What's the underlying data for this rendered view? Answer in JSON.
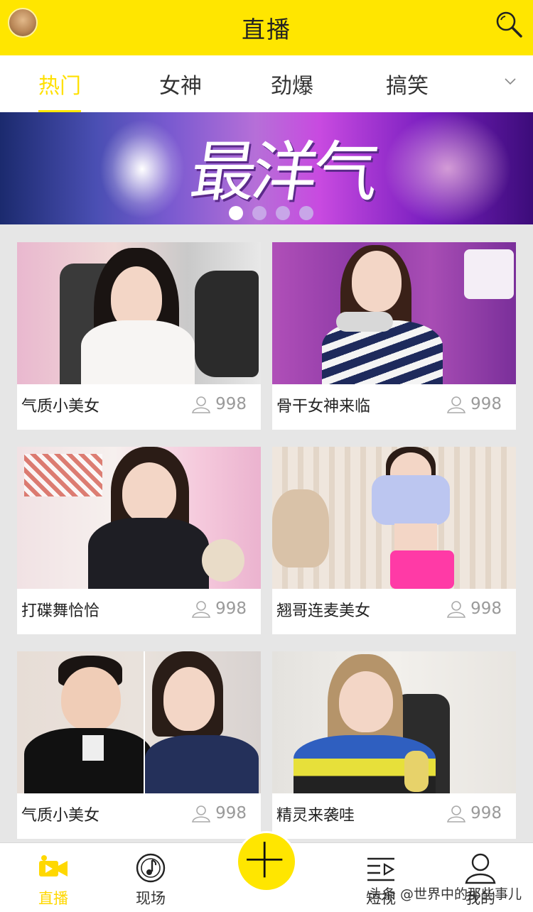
{
  "header": {
    "title": "直播"
  },
  "tabs": [
    {
      "label": "热门",
      "active": true
    },
    {
      "label": "女神",
      "active": false
    },
    {
      "label": "劲爆",
      "active": false
    },
    {
      "label": "搞笑",
      "active": false
    }
  ],
  "banner": {
    "text": "最洋气",
    "slide_count": 4,
    "active_slide": 1
  },
  "streams": [
    {
      "title": "气质小美女",
      "viewers": "998"
    },
    {
      "title": "骨干女神来临",
      "viewers": "998"
    },
    {
      "title": "打碟舞恰恰",
      "viewers": "998"
    },
    {
      "title": "翘哥连麦美女",
      "viewers": "998"
    },
    {
      "title": "气质小美女",
      "viewers": "998"
    },
    {
      "title": "精灵来袭哇",
      "viewers": "998"
    }
  ],
  "bottom_nav": [
    {
      "label": "直播",
      "icon": "video-camera-icon",
      "active": true
    },
    {
      "label": "现场",
      "icon": "music-disc-icon",
      "active": false
    },
    {
      "label": "短视",
      "icon": "playlist-icon",
      "active": false
    },
    {
      "label": "我的",
      "icon": "user-icon",
      "active": false
    }
  ],
  "watermark": "头条 @世界中的那些事儿",
  "colors": {
    "accent": "#ffe600",
    "accent_text": "#ffd800"
  }
}
